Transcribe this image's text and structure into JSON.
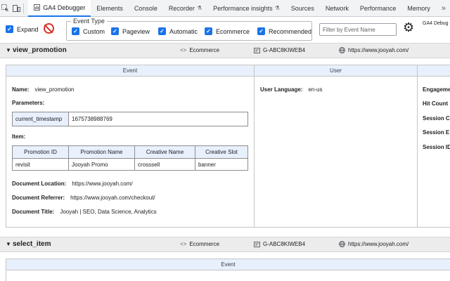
{
  "devtools_tabs": {
    "icons": [
      "inspect-element",
      "device-toolbar"
    ],
    "items": [
      {
        "label": "GA4 Debugger",
        "active": true
      },
      {
        "label": "Elements"
      },
      {
        "label": "Console"
      },
      {
        "label": "Recorder",
        "experimental": true
      },
      {
        "label": "Performance insights",
        "experimental": true
      },
      {
        "label": "Sources"
      },
      {
        "label": "Network"
      },
      {
        "label": "Performance"
      },
      {
        "label": "Memory"
      }
    ],
    "more": "»",
    "experimental_glyph": "⚗"
  },
  "toolbar": {
    "expand_label": "Expand",
    "check_mark": "✓",
    "event_type_legend": "Event Type",
    "event_types": [
      "Custom",
      "Pageview",
      "Automatic",
      "Ecommerce",
      "Recommended"
    ],
    "filter_placeholder": "Filter by Event Name",
    "gear": "⚙",
    "corner_label": "GA4 Debug"
  },
  "events": [
    {
      "toggle": "▼",
      "name": "view_promotion",
      "type_icon": "<>",
      "type": "Ecommerce",
      "measurement_id": "G-ABC8KIWEB4",
      "url": "https://www.jooyah.com/",
      "event_panel": {
        "header": "Event",
        "name_label": "Name:",
        "name_value": "view_promotion",
        "parameters_label": "Parameters:",
        "parameters": [
          {
            "key": "current_timestamp",
            "value": "1675738988769"
          }
        ],
        "item_label": "Item:",
        "item_columns": [
          "Promotion ID",
          "Promotion Name",
          "Creative Name",
          "Creative Slot"
        ],
        "item_rows": [
          [
            "revisit",
            "Jooyah Promo",
            "crosssell",
            "banner"
          ]
        ],
        "location_label": "Document Location:",
        "location_value": "https://www.jooyah.com/",
        "referrer_label": "Document Referrer:",
        "referrer_value": "https://www.jooyah.com/checkout/",
        "title_label": "Document Title:",
        "title_value": "Jooyah | SEO, Data Science, Analytics"
      },
      "user_panel": {
        "header": "User",
        "language_label": "User Language:",
        "language_value": "en-us"
      },
      "session_panel": {
        "labels": [
          "Engageme",
          "Hit Count",
          "Session C",
          "Session E",
          "Session ID"
        ]
      }
    },
    {
      "toggle": "▼",
      "name": "select_item",
      "type_icon": "<>",
      "type": "Ecommerce",
      "measurement_id": "G-ABC8KIWEB4",
      "url": "https://www.jooyah.com/",
      "event_panel": {
        "header": "Event"
      }
    }
  ]
}
